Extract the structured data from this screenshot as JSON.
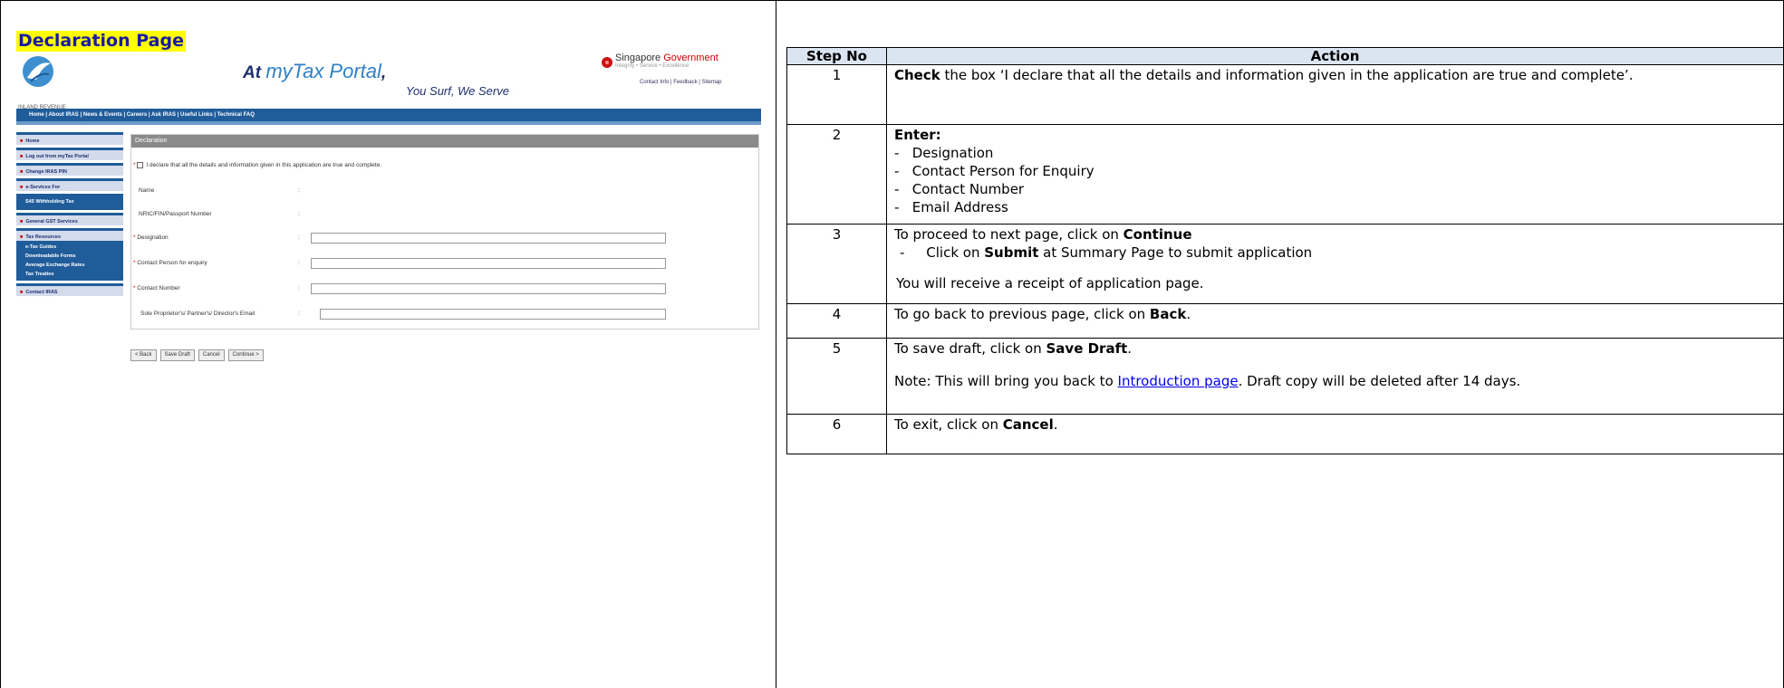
{
  "heading": "Declaration Page",
  "screenshot": {
    "portal_prefix": "At",
    "portal_name": "myTax Portal",
    "portal_comma": ",",
    "portal_tagline": "You Surf, We Serve",
    "iras_name": "INLAND REVENUE AUTHORITY OF SINGAPORE",
    "sg_gov": "Singapore",
    "sg_gov_red": "Government",
    "sg_tagline": "Integrity • Service • Excellence",
    "top_links": "Contact Info | Feedback | Sitemap",
    "nav": "Home  |  About IRAS  |  News & Events  |  Careers  |  Ask IRAS  |  Useful Links  |  Technical FAQ",
    "sidebar": [
      {
        "label": "Home"
      },
      {
        "label": "Log out from myTax Portal"
      },
      {
        "label": "Change IRAS PIN"
      },
      {
        "label": "e-Services For"
      }
    ],
    "sidebar_sub1": "S45 Withholding Tax",
    "sidebar_general": "General GST Services",
    "sidebar_resources": "Tax Resources",
    "sidebar_resource_items": [
      "e-Tax Guides",
      "Downloadable Forms",
      "Average Exchange Rates",
      "Tax Treaties"
    ],
    "sidebar_contact": "Contact IRAS",
    "panel_title": "Declaration",
    "declaration_text": "I declare that all the details and information given in this application are true and complete.",
    "field_name": "Name",
    "field_nric": "NRIC/FIN/Passport Number",
    "field_designation": "Designation",
    "field_contact_person": "Contact Person for enquiry",
    "field_contact_number": "Contact Number",
    "field_email": "Sole Proprietor's/ Partner's/ Director's Email",
    "buttons": [
      "< Back",
      "Save Draft",
      "Cancel",
      "Continue >"
    ]
  },
  "table": {
    "col_step": "Step No",
    "col_action": "Action",
    "rows": [
      {
        "step": "1",
        "bold": "Check",
        "text": " the box ‘I declare that all the details and information given in the application are true and complete’."
      },
      {
        "step": "2",
        "bold": "Enter:",
        "items": [
          "Designation",
          "Contact Person for Enquiry",
          "Contact Number",
          "Email Address"
        ]
      },
      {
        "step": "3",
        "lead": "To proceed to next page, click on ",
        "lead_bold": "Continue",
        "sub_pre": "Click on ",
        "sub_bold": "Submit",
        "sub_post": " at Summary Page to submit application",
        "note": "You will receive a receipt of application page."
      },
      {
        "step": "4",
        "pre": "To go back to previous page, click on ",
        "bold": "Back",
        "post": "."
      },
      {
        "step": "5",
        "pre": "To save draft, click on ",
        "bold": "Save Draft",
        "post": ".",
        "note_pre": "Note: This will bring you back to ",
        "note_link": "Introduction page",
        "note_post": ". Draft copy will be deleted after 14 days."
      },
      {
        "step": "6",
        "pre": "To exit, click on ",
        "bold": "Cancel",
        "post": "."
      }
    ]
  }
}
